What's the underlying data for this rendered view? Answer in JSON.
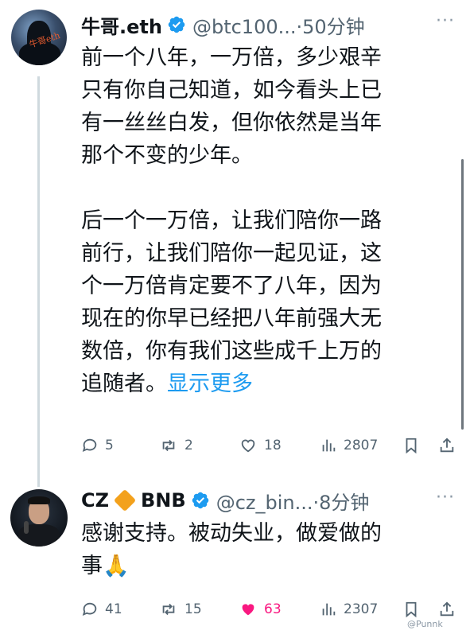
{
  "tweets": [
    {
      "author": "牛哥.eth",
      "handle": "@btc100...",
      "time": "·50分钟",
      "text_lines": [
        "前一个八年，一万倍，多少艰辛",
        "只有你自己知道，如今看头上已",
        "有一丝丝白发，但你依然是当年",
        "那个不变的少年。",
        "",
        "后一个一万倍，让我们陪你一路",
        "前行，让我们陪你一起见证，这",
        "个一万倍肯定要不了八年，因为",
        "现在的你早已经把八年前强大无",
        "数倍，你有我们这些成千上万的",
        "追随者。"
      ],
      "show_more": "显示更多",
      "stats": {
        "replies": "5",
        "reposts": "2",
        "likes": "18",
        "views": "2807"
      }
    },
    {
      "author": "CZ",
      "author_suffix": "BNB",
      "handle": "@cz_bin...",
      "time": "·8分钟",
      "text_lines": [
        "感谢支持。被动失业，做爱做的",
        "事🙏"
      ],
      "stats": {
        "replies": "41",
        "reposts": "15",
        "likes": "63",
        "views": "2307"
      }
    }
  ],
  "more_glyph": "···",
  "watermark": "@Punnk",
  "colors": {
    "accent": "#1d9bf0",
    "like": "#f91880",
    "muted": "#536471",
    "diamond": "#f3a11c"
  },
  "icons": [
    "verified-badge-icon",
    "reply-icon",
    "repost-icon",
    "like-icon",
    "views-icon",
    "bookmark-icon",
    "share-icon",
    "more-icon",
    "diamond-icon"
  ]
}
